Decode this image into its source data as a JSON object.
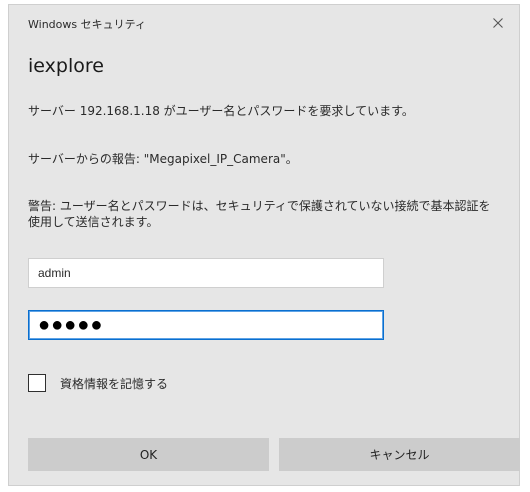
{
  "window": {
    "title": "Windows セキュリティ",
    "close_icon": "close-icon"
  },
  "dialog": {
    "app_name": "iexplore",
    "request_message": "サーバー 192.168.1.18 がユーザー名とパスワードを要求しています。",
    "realm_message": "サーバーからの報告: \"Megapixel_IP_Camera\"。",
    "warning_message": "警告: ユーザー名とパスワードは、セキュリティで保護されていない接続で基本認証を使用して送信されます。"
  },
  "form": {
    "username_value": "admin",
    "password_value": "●●●●●",
    "remember_label": "資格情報を記憶する",
    "remember_checked": false
  },
  "buttons": {
    "ok_label": "OK",
    "cancel_label": "キャンセル"
  },
  "colors": {
    "dialog_background": "#e6e6e6",
    "button_background": "#cccccc",
    "focus_border": "#0a6fcf"
  }
}
